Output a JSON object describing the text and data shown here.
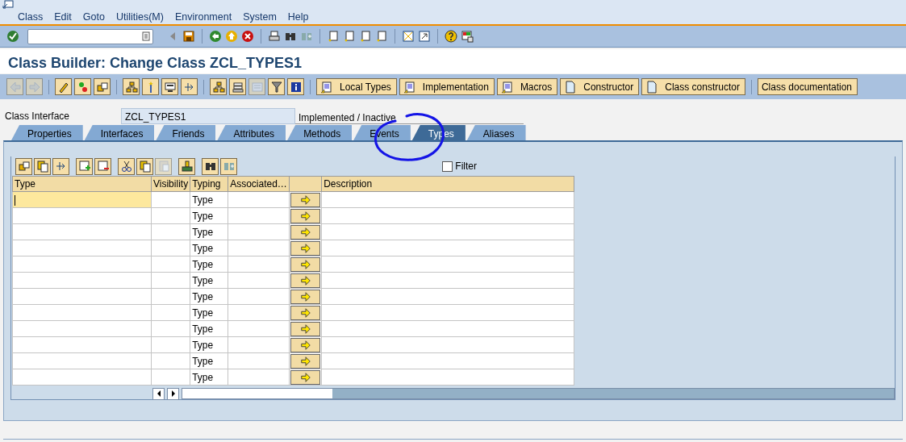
{
  "menu": [
    {
      "label": "Class"
    },
    {
      "label": "Edit"
    },
    {
      "label": "Goto"
    },
    {
      "label": "Utilities(M)"
    },
    {
      "label": "Environment"
    },
    {
      "label": "System"
    },
    {
      "label": "Help"
    }
  ],
  "title": "Class Builder: Change Class ZCL_TYPES1",
  "app_buttons": [
    {
      "label": "Local Types",
      "kind": "list"
    },
    {
      "label": "Implementation",
      "kind": "list"
    },
    {
      "label": "Macros",
      "kind": "list"
    },
    {
      "label": "Constructor",
      "kind": "page"
    },
    {
      "label": "Class constructor",
      "kind": "page"
    },
    {
      "label": "Class documentation",
      "kind": "plain"
    }
  ],
  "header": {
    "label": "Class Interface",
    "value": "ZCL_TYPES1",
    "status": "Implemented / Inactive"
  },
  "tabs": [
    {
      "label": "Properties",
      "selected": false
    },
    {
      "label": "Interfaces",
      "selected": false
    },
    {
      "label": "Friends",
      "selected": false
    },
    {
      "label": "Attributes",
      "selected": false
    },
    {
      "label": "Methods",
      "selected": false
    },
    {
      "label": "Events",
      "selected": false
    },
    {
      "label": "Types",
      "selected": true
    },
    {
      "label": "Aliases",
      "selected": false
    }
  ],
  "filter": {
    "label": "Filter",
    "checked": false
  },
  "table": {
    "columns": [
      {
        "label": "Type",
        "kind": "text"
      },
      {
        "label": "Visibility",
        "kind": "text"
      },
      {
        "label": "Typing",
        "kind": "text"
      },
      {
        "label": "Associated…",
        "kind": "text"
      },
      {
        "kind": "action"
      },
      {
        "label": "Description",
        "kind": "text"
      }
    ],
    "rows": [
      {
        "typing": "Type",
        "focused": true
      },
      {
        "typing": "Type",
        "focused": false
      },
      {
        "typing": "Type",
        "focused": false
      },
      {
        "typing": "Type",
        "focused": false
      },
      {
        "typing": "Type",
        "focused": false
      },
      {
        "typing": "Type",
        "focused": false
      },
      {
        "typing": "Type",
        "focused": false
      },
      {
        "typing": "Type",
        "focused": false
      },
      {
        "typing": "Type",
        "focused": false
      },
      {
        "typing": "Type",
        "focused": false
      },
      {
        "typing": "Type",
        "focused": false
      },
      {
        "typing": "Type",
        "focused": false
      }
    ]
  }
}
